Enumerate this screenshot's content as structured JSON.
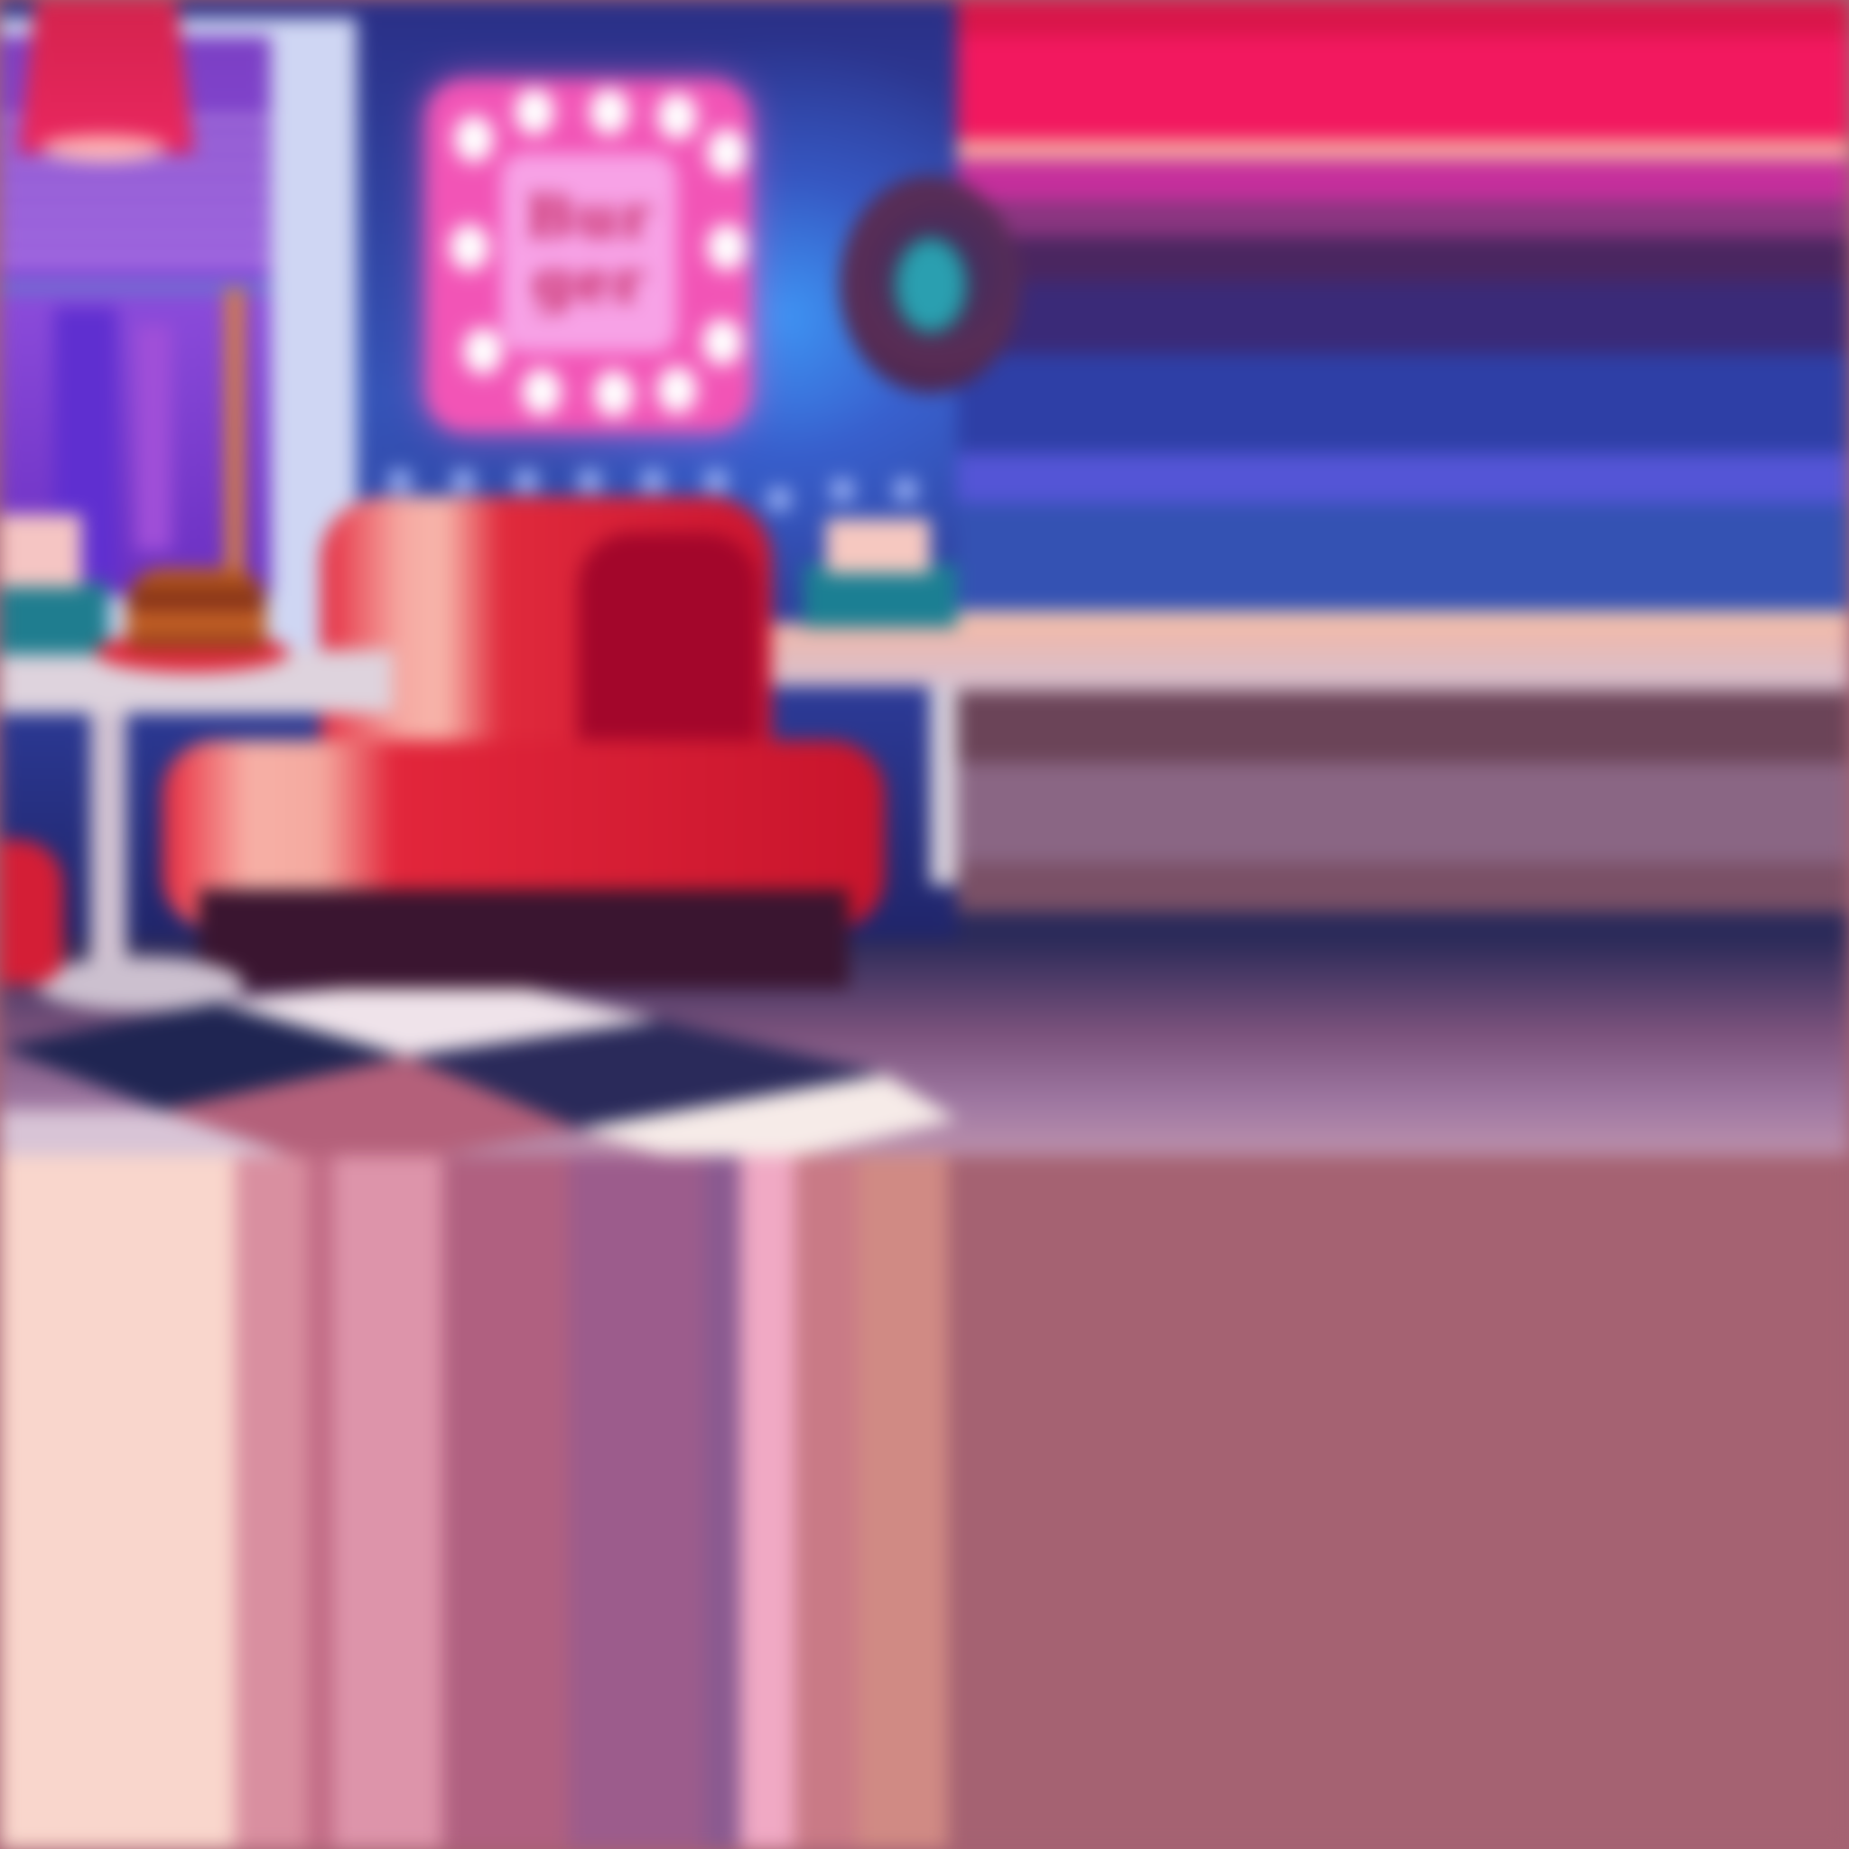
{
  "scene": {
    "description_name": "retro-diner-interior",
    "sign": {
      "text_line1": "Bur",
      "text_line2": "ger"
    }
  },
  "colors": {
    "wall": "#3554b8",
    "sign": "#f254b6",
    "booth": "#e02a3c",
    "lamp": "#e02255",
    "floor": "#a56272"
  }
}
